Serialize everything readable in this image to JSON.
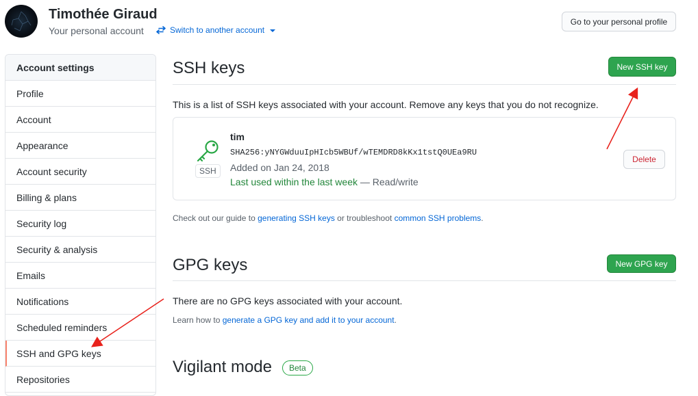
{
  "header": {
    "user_name": "Timothée Giraud",
    "subtitle": "Your personal account",
    "switch_label": "Switch to another account",
    "profile_button": "Go to your personal profile"
  },
  "sidebar": {
    "title": "Account settings",
    "items": [
      {
        "label": "Profile"
      },
      {
        "label": "Account"
      },
      {
        "label": "Appearance"
      },
      {
        "label": "Account security"
      },
      {
        "label": "Billing & plans"
      },
      {
        "label": "Security log"
      },
      {
        "label": "Security & analysis"
      },
      {
        "label": "Emails"
      },
      {
        "label": "Notifications"
      },
      {
        "label": "Scheduled reminders"
      },
      {
        "label": "SSH and GPG keys",
        "selected": true
      },
      {
        "label": "Repositories"
      }
    ]
  },
  "ssh": {
    "title": "SSH keys",
    "new_button": "New SSH key",
    "description": "This is a list of SSH keys associated with your account. Remove any keys that you do not recognize.",
    "key": {
      "badge": "SSH",
      "name": "tim",
      "fingerprint": "SHA256:yNYGWduuIpHIcb5WBUf/wTEMDRD8kKx1tstQ0UEa9RU",
      "added": "Added on Jan 24, 2018",
      "last_used": "Last used within the last week",
      "access": "— Read/write",
      "delete_button": "Delete"
    },
    "guide_prefix": "Check out our guide to",
    "guide_link1": "generating SSH keys",
    "guide_middle": "or troubleshoot",
    "guide_link2": "common SSH problems",
    "guide_suffix": "."
  },
  "gpg": {
    "title": "GPG keys",
    "new_button": "New GPG key",
    "empty_text": "There are no GPG keys associated with your account.",
    "learn_prefix": "Learn how to",
    "learn_link": "generate a GPG key and add it to your account",
    "learn_suffix": "."
  },
  "vigilant": {
    "title": "Vigilant mode",
    "badge": "Beta"
  },
  "colors": {
    "primary_green": "#2ea44f",
    "link_blue": "#0366d6",
    "danger_red": "#cb2431",
    "annotation_red": "#e8221c",
    "selected_accent": "#f9826c"
  },
  "icons": {
    "switch": "arrow-switch-icon",
    "key": "key-icon"
  }
}
